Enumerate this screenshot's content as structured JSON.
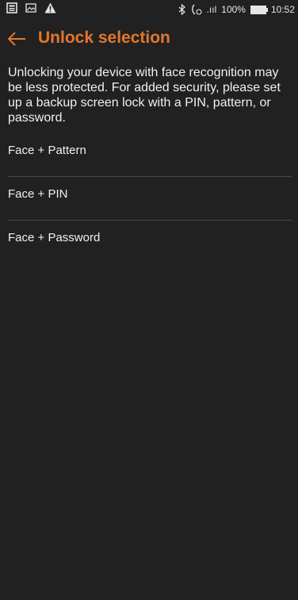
{
  "status_bar": {
    "left_icons": [
      "news-icon",
      "image-icon",
      "warning-icon"
    ],
    "right_icons": [
      "bluetooth-icon",
      "call-forward-icon",
      "signal-icon"
    ],
    "signal_text": ".ııl",
    "battery_percent": "100%",
    "time": "10:52"
  },
  "app_bar": {
    "title": "Unlock selection",
    "accent_color": "#e3772b"
  },
  "description": "Unlocking your device with face recognition may be less protected. For added security, please set up a backup screen lock with a PIN, pattern, or password.",
  "options": [
    {
      "label": "Face + Pattern"
    },
    {
      "label": "Face + PIN"
    },
    {
      "label": "Face + Password"
    }
  ]
}
